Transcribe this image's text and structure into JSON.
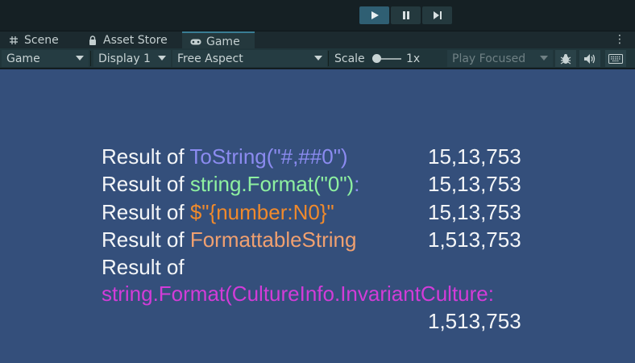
{
  "toolbar": {
    "play_icon": "play-icon",
    "pause_icon": "pause-icon",
    "step_icon": "step-icon"
  },
  "tabs": [
    {
      "label": "Scene",
      "icon": "grid-icon"
    },
    {
      "label": "Asset Store",
      "icon": "lock-icon"
    },
    {
      "label": "Game",
      "icon": "gamepad-icon"
    }
  ],
  "game_controls": {
    "view_dropdown": "Game",
    "display_dropdown": "Display 1",
    "aspect_dropdown": "Free Aspect",
    "scale_label": "Scale",
    "scale_value": "1x",
    "play_focused": "Play Focused"
  },
  "colors": {
    "blue": "#8b8bf0",
    "green": "#8ef0a0",
    "orange": "#f08a2c",
    "salmon": "#f0a070",
    "magenta": "#d23cd8",
    "background": "#344f7b"
  },
  "results": {
    "prefix": "Result of ",
    "prefix_short": "Result of",
    "r1_code": "ToString(\"#,##0\")",
    "r1_value": "15,13,753",
    "r2_code": "string.Format(\"0\")",
    "r2_suffix": ":",
    "r2_value": "15,13,753",
    "r3_code": "$\"{number:N0}\"",
    "r3_value": "15,13,753",
    "r4_code": "FormattableString",
    "r4_value": "1,513,753",
    "r5_code": "string.Format(CultureInfo.InvariantCulture:",
    "r5_value": "1,513,753"
  }
}
